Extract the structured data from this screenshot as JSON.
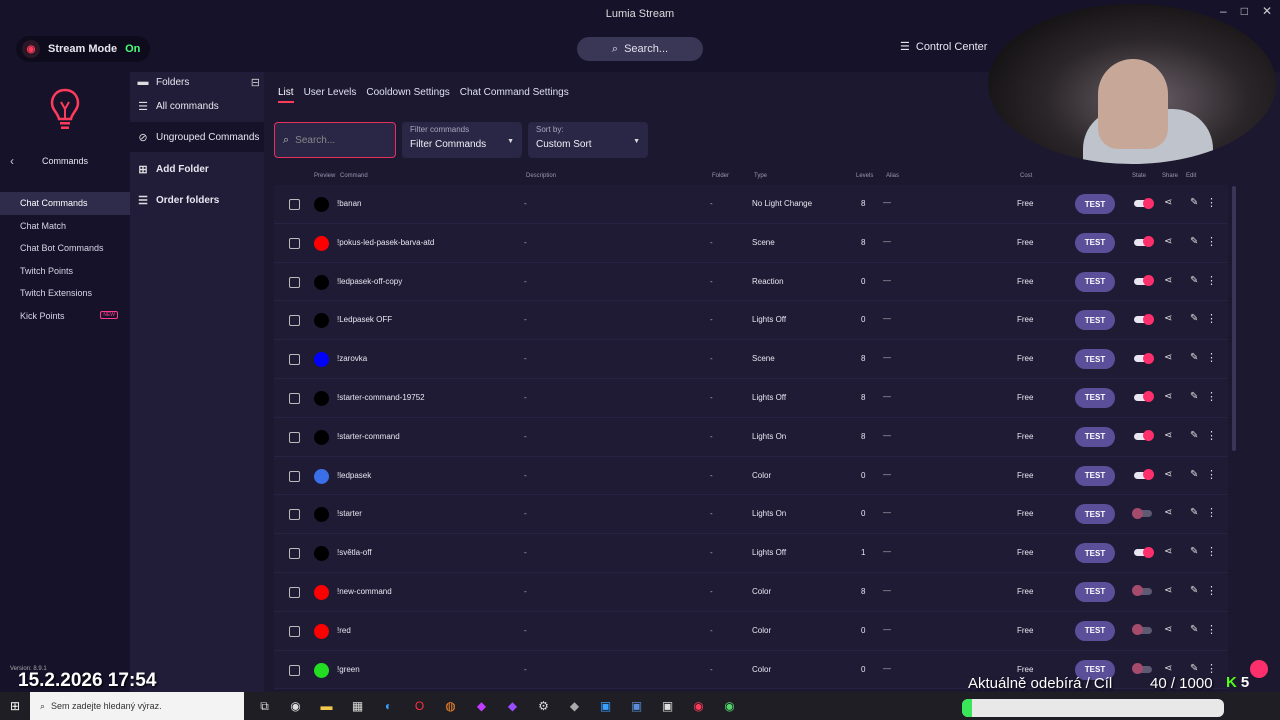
{
  "window": {
    "title": "Lumia Stream"
  },
  "topbar": {
    "stream_mode_label": "Stream Mode",
    "stream_mode_state": "On",
    "search_label": "Search...",
    "control_center_label": "Control Center"
  },
  "sidebar": {
    "back_label": "Commands",
    "items": [
      {
        "label": "Chat Commands",
        "active": true
      },
      {
        "label": "Chat Match"
      },
      {
        "label": "Chat Bot Commands"
      },
      {
        "label": "Twitch Points"
      },
      {
        "label": "Twitch Extensions"
      },
      {
        "label": "Kick Points",
        "badge": "NEW"
      }
    ],
    "version": "Version: 8.9.1"
  },
  "folders": {
    "title": "Folders",
    "all_label": "All commands",
    "ungrouped_label": "Ungrouped Commands",
    "add_label": "Add Folder",
    "order_label": "Order folders"
  },
  "tabs": [
    "List",
    "User Levels",
    "Cooldown Settings",
    "Chat Command Settings"
  ],
  "filters": {
    "search_placeholder": "Search...",
    "filter_label": "Filter commands",
    "filter_value": "Filter Commands",
    "sort_label": "Sort by:",
    "sort_value": "Custom Sort"
  },
  "table": {
    "headers": {
      "preview": "Preview",
      "command": "Command",
      "description": "Description",
      "folder": "Folder",
      "type": "Type",
      "levels": "Levels",
      "alias": "Alias",
      "cost": "Cost",
      "state": "State",
      "share": "Share",
      "edit": "Edit"
    },
    "test_label": "TEST",
    "rows": [
      {
        "command": "!banan",
        "description": "-",
        "folder": "-",
        "type": "No Light Change",
        "levels": "8",
        "alias": "—",
        "cost": "Free",
        "color": "#000000",
        "state": "on"
      },
      {
        "command": "!pokus-led-pasek-barva-atd",
        "description": "-",
        "folder": "-",
        "type": "Scene",
        "levels": "8",
        "alias": "—",
        "cost": "Free",
        "color": "#ff0000",
        "state": "on"
      },
      {
        "command": "!ledpasek-off-copy",
        "description": "-",
        "folder": "-",
        "type": "Reaction",
        "levels": "0",
        "alias": "—",
        "cost": "Free",
        "color": "#000000",
        "state": "on"
      },
      {
        "command": "!Ledpasek OFF",
        "description": "-",
        "folder": "-",
        "type": "Lights Off",
        "levels": "0",
        "alias": "—",
        "cost": "Free",
        "color": "#000000",
        "state": "on"
      },
      {
        "command": "!zarovka",
        "description": "-",
        "folder": "-",
        "type": "Scene",
        "levels": "8",
        "alias": "—",
        "cost": "Free",
        "color": "#0000ff",
        "state": "on"
      },
      {
        "command": "!starter-command-19752",
        "description": "-",
        "folder": "-",
        "type": "Lights Off",
        "levels": "8",
        "alias": "—",
        "cost": "Free",
        "color": "#000000",
        "state": "on"
      },
      {
        "command": "!starter-command",
        "description": "-",
        "folder": "-",
        "type": "Lights On",
        "levels": "8",
        "alias": "—",
        "cost": "Free",
        "color": "#000000",
        "state": "on"
      },
      {
        "command": "!ledpasek",
        "description": "-",
        "folder": "-",
        "type": "Color",
        "levels": "0",
        "alias": "—",
        "cost": "Free",
        "color": "#3b6fe8",
        "state": "on"
      },
      {
        "command": "!starter",
        "description": "-",
        "folder": "-",
        "type": "Lights On",
        "levels": "0",
        "alias": "—",
        "cost": "Free",
        "color": "#000000",
        "state": "off"
      },
      {
        "command": "!světla-off",
        "description": "-",
        "folder": "-",
        "type": "Lights Off",
        "levels": "1",
        "alias": "—",
        "cost": "Free",
        "color": "#000000",
        "state": "on"
      },
      {
        "command": "!new-command",
        "description": "-",
        "folder": "-",
        "type": "Color",
        "levels": "8",
        "alias": "—",
        "cost": "Free",
        "color": "#ff0000",
        "state": "off"
      },
      {
        "command": "!red",
        "description": "-",
        "folder": "-",
        "type": "Color",
        "levels": "0",
        "alias": "—",
        "cost": "Free",
        "color": "#ff0000",
        "state": "off"
      },
      {
        "command": "!green",
        "description": "-",
        "folder": "-",
        "type": "Color",
        "levels": "0",
        "alias": "—",
        "cost": "Free",
        "color": "#22dd22",
        "state": "off"
      }
    ]
  },
  "taskbar": {
    "search_placeholder": "Sem zadejte hledaný výraz."
  },
  "overlay": {
    "datetime": "15.2.2026 17:54",
    "sub_goal_label": "Aktuálně odebírá / Cíl",
    "sub_count": "40 / 1000",
    "sub_progress": 0.04,
    "kick_count": "5"
  },
  "colors": {
    "accent": "#ff2f6b",
    "test_button": "#5b4f9a",
    "bg": "#1b1830"
  }
}
